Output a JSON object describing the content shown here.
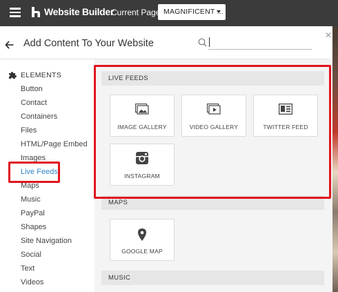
{
  "topbar": {
    "brand": "Website Builder",
    "current_page_label": "Current Page:",
    "current_page_value": "MAGNIFICENT ..."
  },
  "header": {
    "title": "Add Content To Your Website",
    "search_placeholder": ""
  },
  "sidebar": {
    "category": "ELEMENTS",
    "items": [
      {
        "label": "Button"
      },
      {
        "label": "Contact"
      },
      {
        "label": "Containers"
      },
      {
        "label": "Files"
      },
      {
        "label": "HTML/Page Embed"
      },
      {
        "label": "Images"
      },
      {
        "label": "Live Feeds",
        "active": true
      },
      {
        "label": "Maps"
      },
      {
        "label": "Music"
      },
      {
        "label": "PayPal"
      },
      {
        "label": "Shapes"
      },
      {
        "label": "Site Navigation"
      },
      {
        "label": "Social"
      },
      {
        "label": "Text"
      },
      {
        "label": "Videos"
      }
    ]
  },
  "sections": {
    "live_feeds": {
      "title": "LIVE FEEDS",
      "tiles": [
        {
          "label": "IMAGE GALLERY",
          "icon": "image-gallery-icon"
        },
        {
          "label": "VIDEO GALLERY",
          "icon": "video-gallery-icon"
        },
        {
          "label": "TWITTER FEED",
          "icon": "twitter-feed-icon"
        },
        {
          "label": "INSTAGRAM",
          "icon": "instagram-icon"
        }
      ]
    },
    "maps": {
      "title": "MAPS",
      "tiles": [
        {
          "label": "GOOGLE MAP",
          "icon": "map-pin-icon"
        }
      ]
    },
    "music": {
      "title": "MUSIC"
    }
  },
  "colors": {
    "topbar": "#3b3b3b",
    "active_link": "#2f86c5",
    "highlight": "#e0141e"
  }
}
